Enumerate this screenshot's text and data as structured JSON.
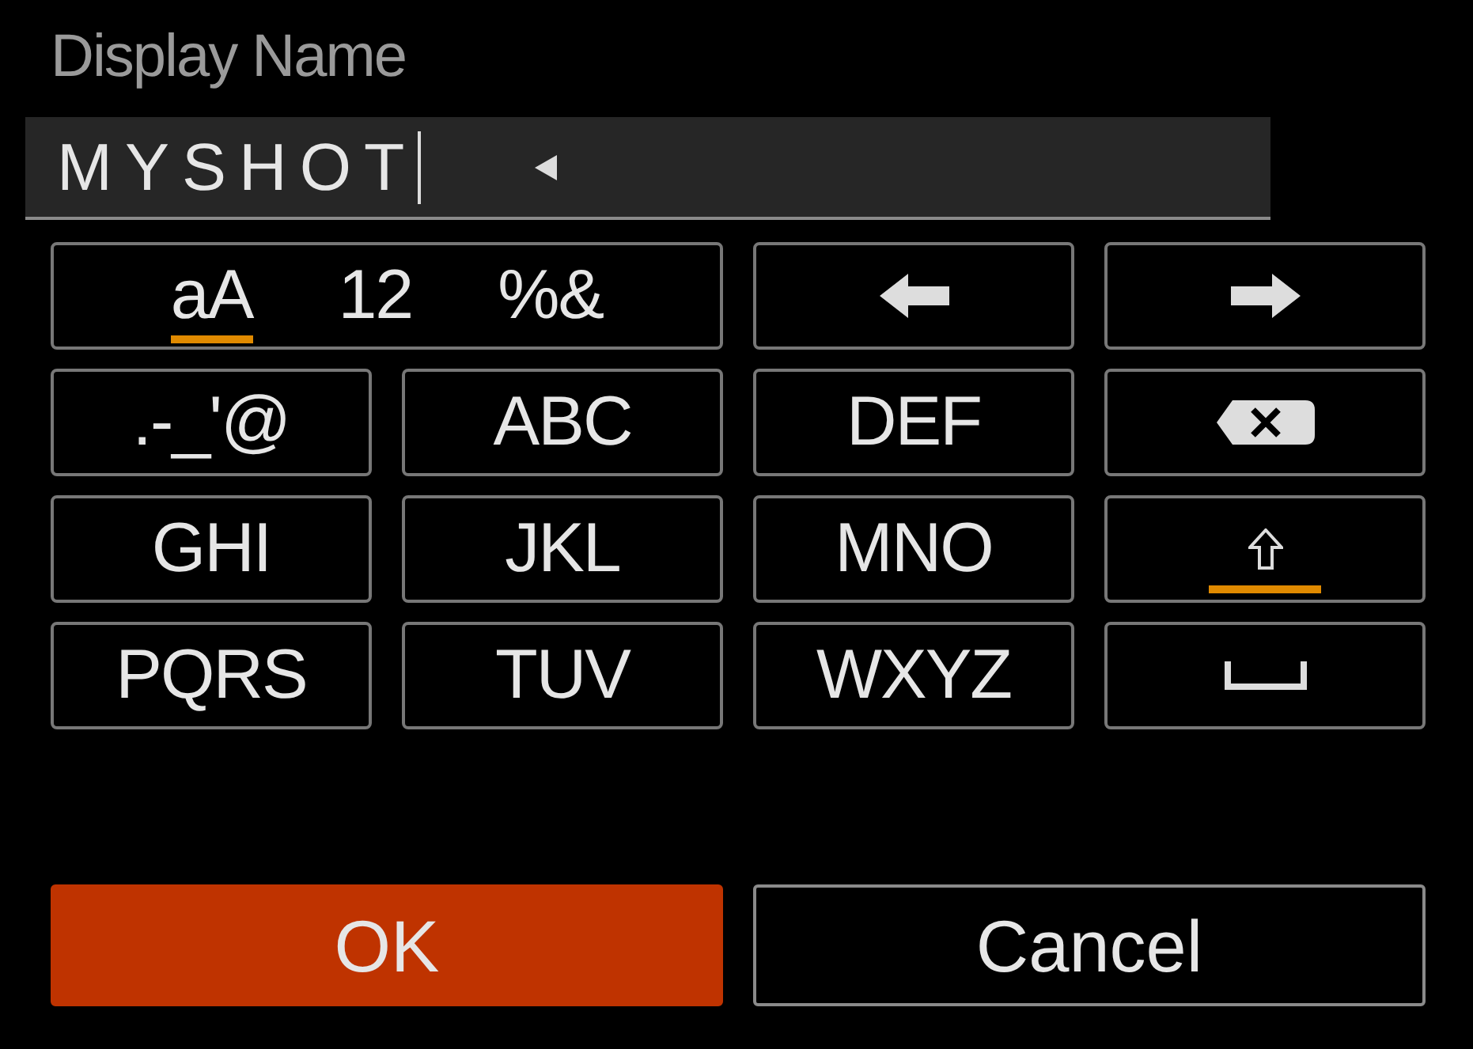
{
  "field": {
    "label": "Display Name",
    "value": "MYSHOT"
  },
  "mode_key": {
    "modes": [
      {
        "label": "aA",
        "selected": true
      },
      {
        "label": "12",
        "selected": false
      },
      {
        "label": "%&",
        "selected": false
      }
    ]
  },
  "keys": [
    {
      "kind": "left"
    },
    {
      "kind": "right"
    },
    {
      "kind": "text",
      "label": ".-_'@"
    },
    {
      "kind": "text",
      "label": "ABC"
    },
    {
      "kind": "text",
      "label": "DEF"
    },
    {
      "kind": "backspace"
    },
    {
      "kind": "text",
      "label": "GHI"
    },
    {
      "kind": "text",
      "label": "JKL"
    },
    {
      "kind": "text",
      "label": "MNO"
    },
    {
      "kind": "shift",
      "on": true
    },
    {
      "kind": "text",
      "label": "PQRS"
    },
    {
      "kind": "text",
      "label": "TUV"
    },
    {
      "kind": "text",
      "label": "WXYZ"
    },
    {
      "kind": "space"
    }
  ],
  "buttons": [
    {
      "label": "OK",
      "selected": true
    },
    {
      "label": "Cancel",
      "selected": false
    }
  ]
}
